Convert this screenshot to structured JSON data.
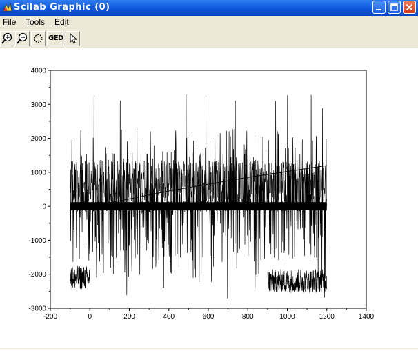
{
  "window": {
    "title": "Scilab Graphic (0)",
    "colors": {
      "titlebar": "#0a52d8",
      "chrome": "#ece9d8",
      "plot_line": "#000000"
    }
  },
  "menubar": {
    "items": [
      {
        "label": "File"
      },
      {
        "label": "Tools"
      },
      {
        "label": "Edit"
      }
    ]
  },
  "toolbar": {
    "tools": [
      {
        "icon": "zoom-in-icon"
      },
      {
        "icon": "zoom-out-icon"
      },
      {
        "icon": "rotate-icon"
      },
      {
        "icon": "ged-icon",
        "label": "GED"
      },
      {
        "icon": "pointer-icon"
      }
    ]
  },
  "chart_data": {
    "type": "line",
    "xlim": [
      -200,
      1400
    ],
    "ylim": [
      -3000,
      4000
    ],
    "xticks": [
      -200,
      0,
      200,
      400,
      600,
      800,
      1000,
      1200,
      1400
    ],
    "yticks": [
      -3000,
      -2000,
      -1000,
      0,
      1000,
      2000,
      3000,
      4000
    ],
    "grid": false,
    "series": [
      {
        "style": "dense noisy signal",
        "x_range": [
          -100,
          1200
        ],
        "baseline": 0,
        "typical_band": [
          -2200,
          2200
        ],
        "peak_max": 3350,
        "peak_min": -2900,
        "negative_offset_clusters": [
          {
            "x_range": [
              -100,
              0
            ],
            "level": -2100
          },
          {
            "x_range": [
              900,
              1200
            ],
            "level": -2200
          }
        ]
      },
      {
        "style": "trend line",
        "points": [
          [
            100,
            100
          ],
          [
            400,
            450
          ],
          [
            800,
            850
          ],
          [
            1200,
            1200
          ]
        ]
      }
    ]
  }
}
